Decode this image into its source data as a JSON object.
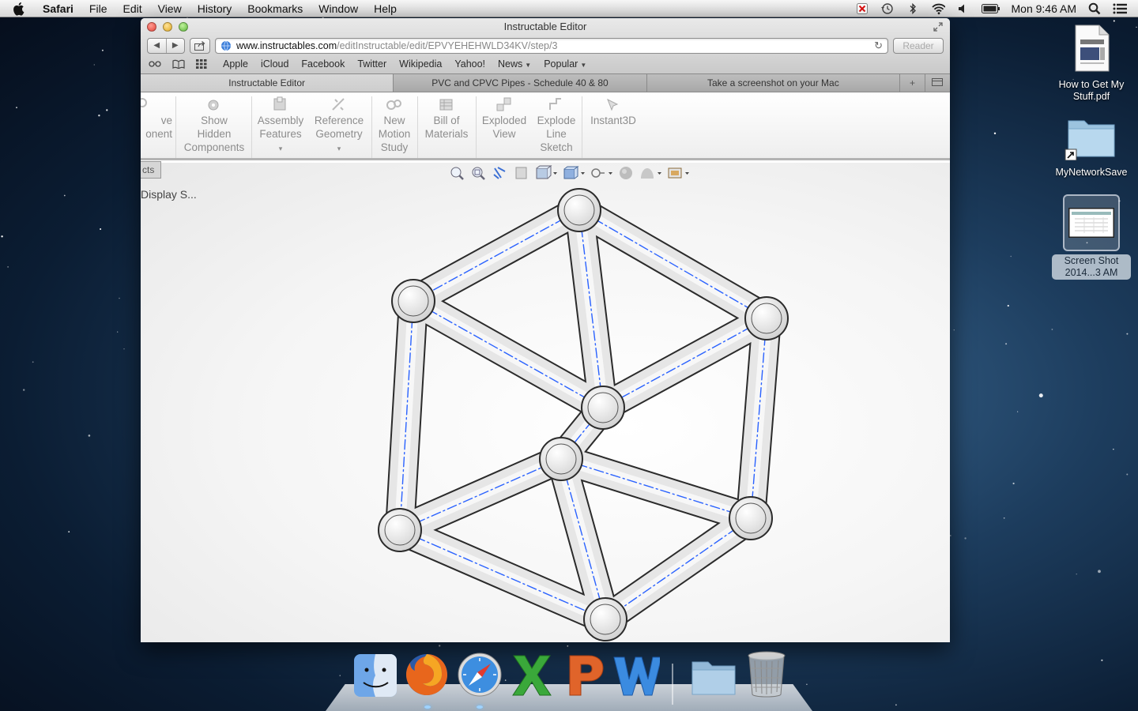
{
  "menubar": {
    "app_name": "Safari",
    "items": [
      "File",
      "Edit",
      "View",
      "History",
      "Bookmarks",
      "Window",
      "Help"
    ],
    "clock": "Mon 9:46 AM",
    "status_icons": [
      "close-status-icon",
      "time-machine-icon",
      "bluetooth-icon",
      "wifi-icon",
      "volume-icon",
      "battery-icon",
      "spotlight-icon",
      "notification-icon"
    ]
  },
  "window": {
    "title": "Instructable Editor",
    "url_domain": "www.instructables.com",
    "url_path": "/editInstructable/edit/EPVYEHEHWLD34KV/step/3",
    "reader_label": "Reader",
    "favorites": [
      {
        "label": "Apple",
        "has_menu": false
      },
      {
        "label": "iCloud",
        "has_menu": false
      },
      {
        "label": "Facebook",
        "has_menu": false
      },
      {
        "label": "Twitter",
        "has_menu": false
      },
      {
        "label": "Wikipedia",
        "has_menu": false
      },
      {
        "label": "Yahoo!",
        "has_menu": false
      },
      {
        "label": "News",
        "has_menu": true
      },
      {
        "label": "Popular",
        "has_menu": true
      }
    ],
    "tabs": [
      {
        "label": "Instructable Editor",
        "active": true
      },
      {
        "label": "PVC and CPVC Pipes - Schedule 40 & 80",
        "active": false
      },
      {
        "label": "Take a screenshot on your Mac",
        "active": false
      }
    ]
  },
  "cad": {
    "ribbon": [
      {
        "lines": [
          "ve",
          "onent"
        ]
      },
      {
        "lines": [
          "Show",
          "Hidden",
          "Components"
        ]
      },
      {
        "lines": [
          "Assembly",
          "Features"
        ],
        "dropdown": true
      },
      {
        "lines": [
          "Reference",
          "Geometry"
        ],
        "dropdown": true
      },
      {
        "lines": [
          "New",
          "Motion",
          "Study"
        ]
      },
      {
        "lines": [
          "Bill of",
          "Materials"
        ]
      },
      {
        "lines": [
          "Exploded",
          "View"
        ]
      },
      {
        "lines": [
          "Explode",
          "Line",
          "Sketch"
        ]
      },
      {
        "lines": [
          "Instant3D"
        ]
      }
    ],
    "panel_tab": "cts",
    "display_label": "Display S...",
    "hud_icons": [
      "zoom-to-fit-icon",
      "zoom-area-icon",
      "previous-view-icon",
      "section-view-icon",
      "view-orientation-icon",
      "display-style-icon",
      "hide-show-icon",
      "edit-appearance-icon",
      "apply-scene-icon",
      "view-settings-icon"
    ]
  },
  "desktop": {
    "icons": [
      {
        "label": "How to Get My Stuff.pdf",
        "selected": false
      },
      {
        "label": "MyNetworkSave",
        "selected": false
      },
      {
        "label": "Screen Shot 2014...3 AM",
        "selected": true
      }
    ]
  },
  "dock": {
    "apps": [
      "Finder",
      "Firefox",
      "Safari",
      "Microsoft Excel",
      "Microsoft PowerPoint",
      "Microsoft Word",
      "Applications Folder",
      "Trash"
    ],
    "running": [
      "Firefox",
      "Safari"
    ]
  },
  "colors": {
    "accent_blue": "#2a62ff",
    "pipe_fill": "#e6e6e6",
    "pipe_outline": "#2b2b2b"
  }
}
